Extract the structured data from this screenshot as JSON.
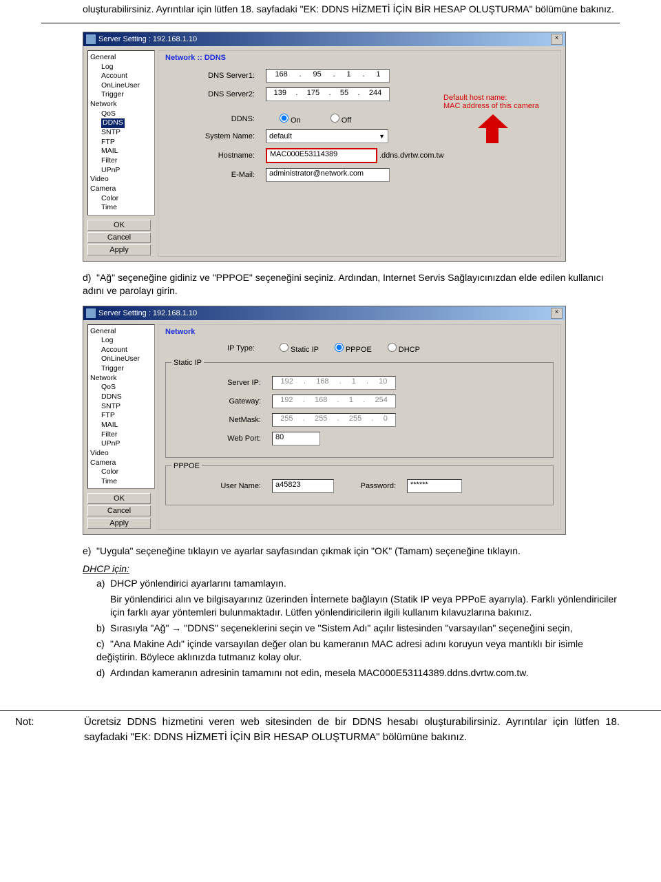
{
  "intro": "oluşturabilirsiniz. Ayrıntılar için lütfen 18. sayfadaki \"EK: DDNS HİZMETİ İÇİN BİR HESAP OLUŞTURMA\" bölümüne bakınız.",
  "win1": {
    "title": "Server Setting : 192.168.1.10",
    "tree": {
      "General": "General",
      "Log": "Log",
      "Account": "Account",
      "OnLineUser": "OnLineUser",
      "Trigger": "Trigger",
      "Network": "Network",
      "QoS": "QoS",
      "DDNS": "DDNS",
      "SNTP": "SNTP",
      "FTP": "FTP",
      "MAIL": "MAIL",
      "Filter": "Filter",
      "UPnP": "UPnP",
      "Video": "Video",
      "Camera": "Camera",
      "Color": "Color",
      "Time": "Time"
    },
    "btns": {
      "ok": "OK",
      "cancel": "Cancel",
      "apply": "Apply"
    },
    "hdr": "Network :: DDNS",
    "dns1_lbl": "DNS Server1:",
    "dns1_v": [
      "168",
      "95",
      "1",
      "1"
    ],
    "dns2_lbl": "DNS Server2:",
    "dns2_v": [
      "139",
      "175",
      "55",
      "244"
    ],
    "ddns_lbl": "DDNS:",
    "on": "On",
    "off": "Off",
    "sysname_lbl": "System Name:",
    "sysname_v": "default",
    "host_lbl": "Hostname:",
    "host_v": "MAC000E53114389",
    "host_suffix": ".ddns.dvrtw.com.tw",
    "email_lbl": "E-Mail:",
    "email_v": "administrator@network.com",
    "red1": "Default host name:",
    "red2": "MAC address of this camera"
  },
  "step_d": "\"Ağ\" seçeneğine gidiniz ve \"PPPOE\" seçeneğini seçiniz. Ardından, Internet Servis Sağlayıcınızdan elde edilen kullanıcı adını ve parolayı girin.",
  "win2": {
    "title": "Server Setting : 192.168.1.10",
    "hdr": "Network",
    "iptype_lbl": "IP Type:",
    "static": "Static IP",
    "pppoe": "PPPOE",
    "dhcp": "DHCP",
    "grp_static": "Static IP",
    "srvip_lbl": "Server IP:",
    "srvip_v": [
      "192",
      "168",
      "1",
      "10"
    ],
    "gw_lbl": "Gateway:",
    "gw_v": [
      "192",
      "168",
      "1",
      "254"
    ],
    "nm_lbl": "NetMask:",
    "nm_v": [
      "255",
      "255",
      "255",
      "0"
    ],
    "wp_lbl": "Web Port:",
    "wp_v": "80",
    "grp_pppoe": "PPPOE",
    "un_lbl": "User Name:",
    "un_v": "a45823",
    "pw_lbl": "Password:",
    "pw_v": "******"
  },
  "step_e": "\"Uygula\" seçeneğine tıklayın ve ayarlar sayfasından çıkmak için \"OK\" (Tamam) seçeneğine tıklayın.",
  "dhcp_head": "DHCP için:",
  "dhcp_a1": "DHCP yönlendirici ayarlarını tamamlayın.",
  "dhcp_a2": "Bir yönlendirici alın ve bilgisayarınız üzerinden İnternete bağlayın (Statik IP veya PPPoE ayarıyla). Farklı yönlendiriciler için farklı ayar yöntemleri bulunmaktadır. Lütfen yönlendiricilerin ilgili kullanım kılavuzlarına bakınız.",
  "dhcp_b": "Sırasıyla \"Ağ\" → \"DDNS\" seçeneklerini seçin ve \"Sistem Adı\" açılır listesinden \"varsayılan\" seçeneğini seçin,",
  "dhcp_c": "\"Ana Makine Adı\" içinde varsayılan değer olan bu kameranın MAC adresi adını koruyun veya mantıklı bir isimle değiştirin. Böylece aklınızda tutmanız kolay olur.",
  "dhcp_d": "Ardından kameranın adresinin tamamını not edin, mesela MAC000E53114389.ddns.dvrtw.com.tw.",
  "not_lbl": "Not:",
  "not_txt": "Ücretsiz DDNS hizmetini veren web sitesinden de bir DDNS hesabı oluşturabilirsiniz. Ayrıntılar için lütfen 18. sayfadaki \"EK: DDNS HİZMETİ İÇİN BİR HESAP OLUŞTURMA\" bölümüne bakınız."
}
